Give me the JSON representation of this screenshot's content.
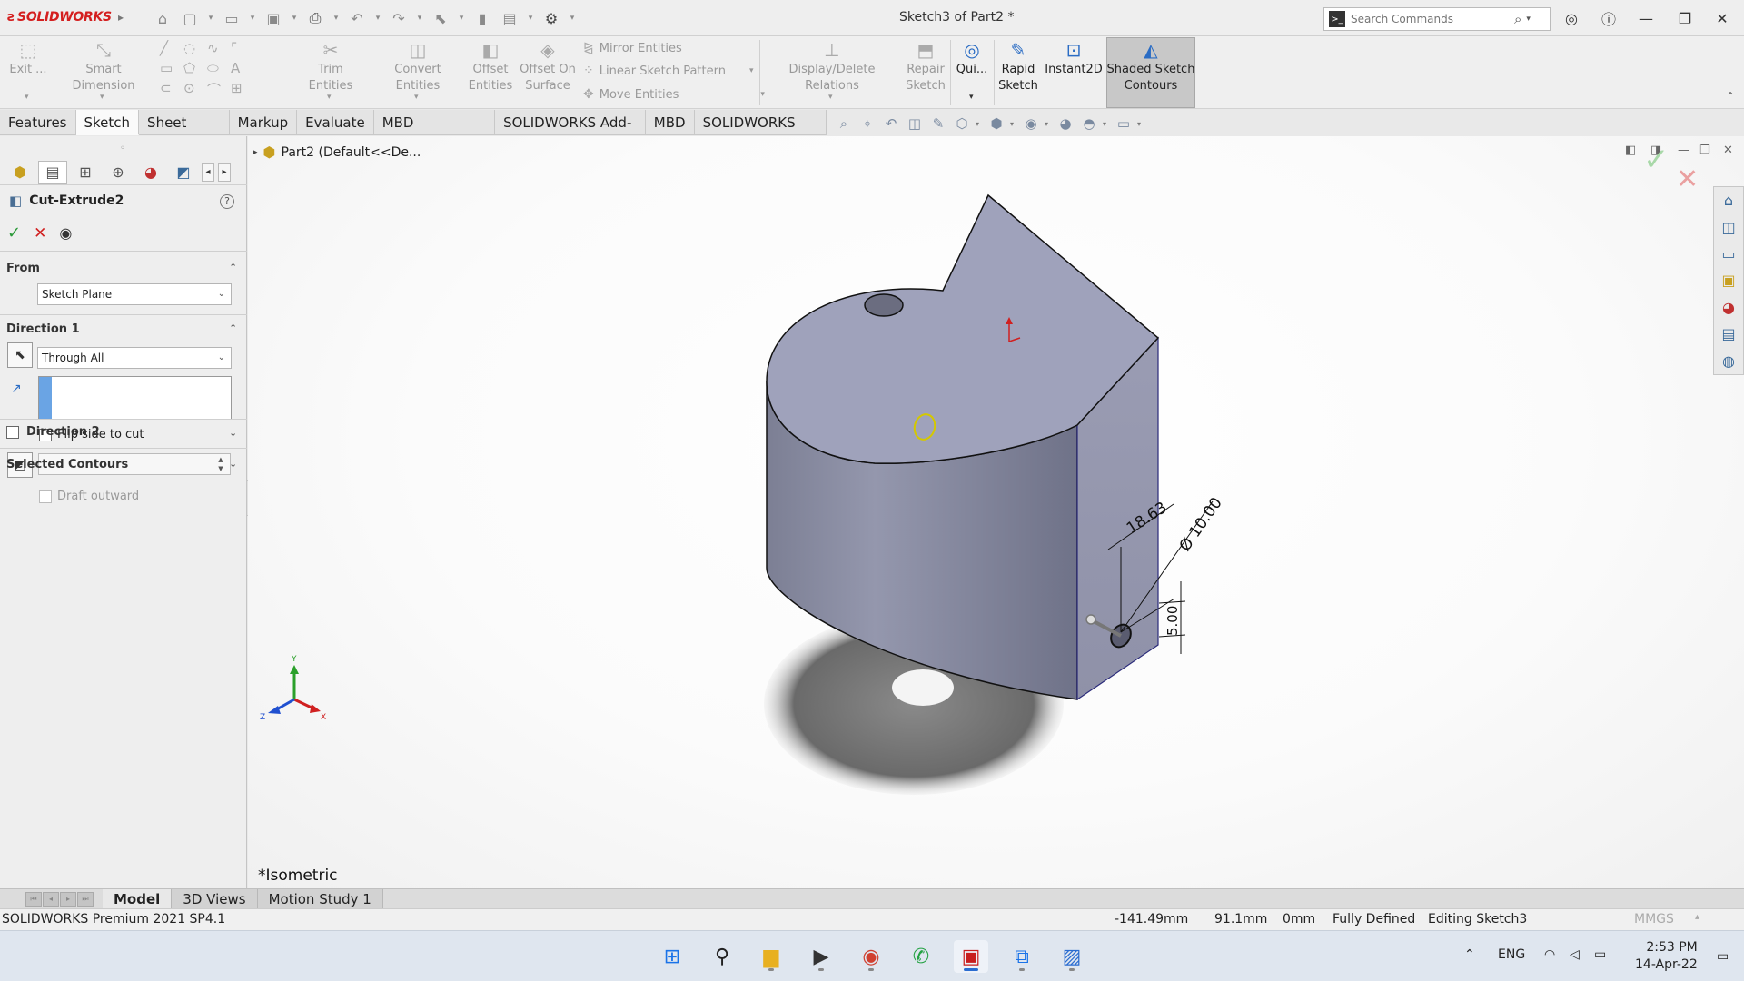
{
  "app": {
    "brand": "SOLIDWORKS",
    "document_title": "Sketch3 of Part2 *"
  },
  "search": {
    "placeholder": "Search Commands"
  },
  "ribbon": {
    "exit": "Exit ...",
    "smart_dimension": "Smart Dimension",
    "trim_entities": "Trim Entities",
    "convert_entities": "Convert Entities",
    "offset_entities_1": "Offset",
    "offset_entities_2": "Entities",
    "offset_on_surface_1": "Offset On",
    "offset_on_surface_2": "Surface",
    "mirror_entities": "Mirror Entities",
    "linear_sketch_pattern": "Linear Sketch Pattern",
    "move_entities": "Move Entities",
    "display_delete_relations": "Display/Delete Relations",
    "repair_sketch_1": "Repair",
    "repair_sketch_2": "Sketch",
    "quick_snaps": "Qui...",
    "rapid_sketch_1": "Rapid",
    "rapid_sketch_2": "Sketch",
    "instant2d": "Instant2D",
    "shaded_contours_1": "Shaded Sketch",
    "shaded_contours_2": "Contours"
  },
  "tabs": [
    "Features",
    "Sketch",
    "Sheet Metal",
    "Markup",
    "Evaluate",
    "MBD Dimensions",
    "SOLIDWORKS Add-Ins",
    "MBD",
    "SOLIDWORKS CAM"
  ],
  "active_tab": "Sketch",
  "property_manager": {
    "feature_name": "Cut-Extrude2",
    "help": "?",
    "from": {
      "title": "From",
      "value": "Sketch Plane"
    },
    "direction1": {
      "title": "Direction 1",
      "end_condition": "Through All",
      "flip_side_label": "Flip side to cut",
      "draft_outward_label": "Draft outward"
    },
    "direction2": {
      "title": "Direction 2"
    },
    "selected_contours": {
      "title": "Selected Contours"
    }
  },
  "tree": {
    "root": "Part2  (Default<<De..."
  },
  "dimensions": {
    "d1": "18.63",
    "d2": "Ø 10.00",
    "d3": "5.00"
  },
  "triad": {
    "x": "X",
    "y": "Y",
    "z": "Z"
  },
  "view_orientation": "*Isometric",
  "bottom_tabs": [
    "Model",
    "3D Views",
    "Motion Study 1"
  ],
  "active_bottom_tab": "Model",
  "status_bar": {
    "product": "SOLIDWORKS Premium 2021 SP4.1",
    "x_coord": "-141.49mm",
    "y_coord": "91.1mm",
    "z_coord": "0mm",
    "sketch_status": "Fully Defined",
    "editing": "Editing Sketch3",
    "units": "MMGS"
  },
  "taskbar": {
    "language": "ENG",
    "time": "2:53 PM",
    "date": "14-Apr-22"
  },
  "colors": {
    "brand_red": "#d41f1f",
    "accent_blue": "#2a6cc4",
    "model_face": "#9a9db6",
    "ok_green": "#2c9a3a",
    "cancel_red": "#d02020"
  }
}
